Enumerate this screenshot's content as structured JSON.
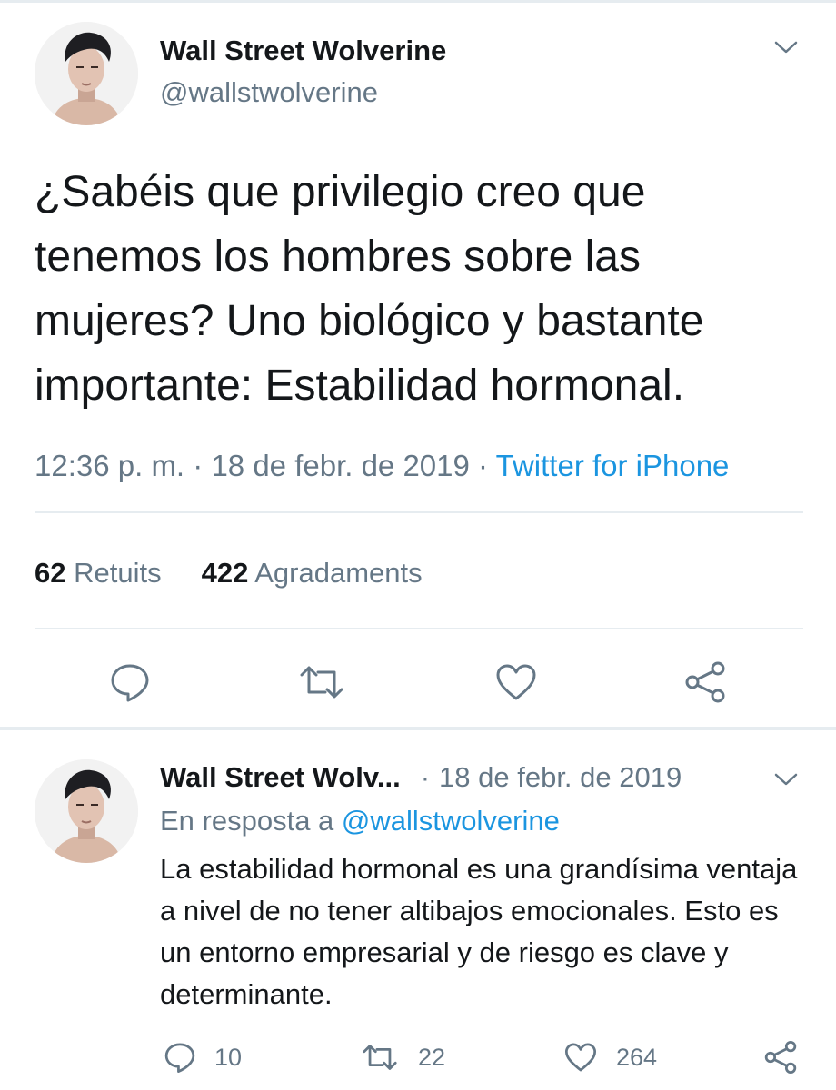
{
  "main_tweet": {
    "display_name": "Wall Street Wolverine",
    "handle": "@wallstwolverine",
    "text": "¿Sabéis que privilegio creo que tenemos los hombres sobre las mujeres? Uno biológico y bastante importante: Estabilidad hormonal.",
    "time": "12:36 p. m.",
    "separator": "·",
    "date": "18 de febr. de 2019",
    "source": "Twitter for iPhone",
    "retweets_count": "62",
    "retweets_label": "Retuits",
    "likes_count": "422",
    "likes_label": "Agradaments",
    "icons": [
      "reply-icon",
      "retweet-icon",
      "like-icon",
      "share-icon"
    ]
  },
  "reply_tweet": {
    "display_name": "Wall Street Wolv...",
    "separator": "·",
    "date": "18 de febr. de 2019",
    "reply_prefix": "En resposta a",
    "reply_mention": "@wallstwolverine",
    "text": "La estabilidad hormonal es una grandísima ventaja a nivel de no tener altibajos emocionales. Esto es un entorno empresarial y de riesgo es clave y determinante.",
    "reply_count": "10",
    "retweet_count": "22",
    "like_count": "264"
  },
  "colors": {
    "primary_text": "#14171a",
    "secondary_text": "#657786",
    "link": "#1b95e0",
    "divider": "#e6ecf0"
  }
}
